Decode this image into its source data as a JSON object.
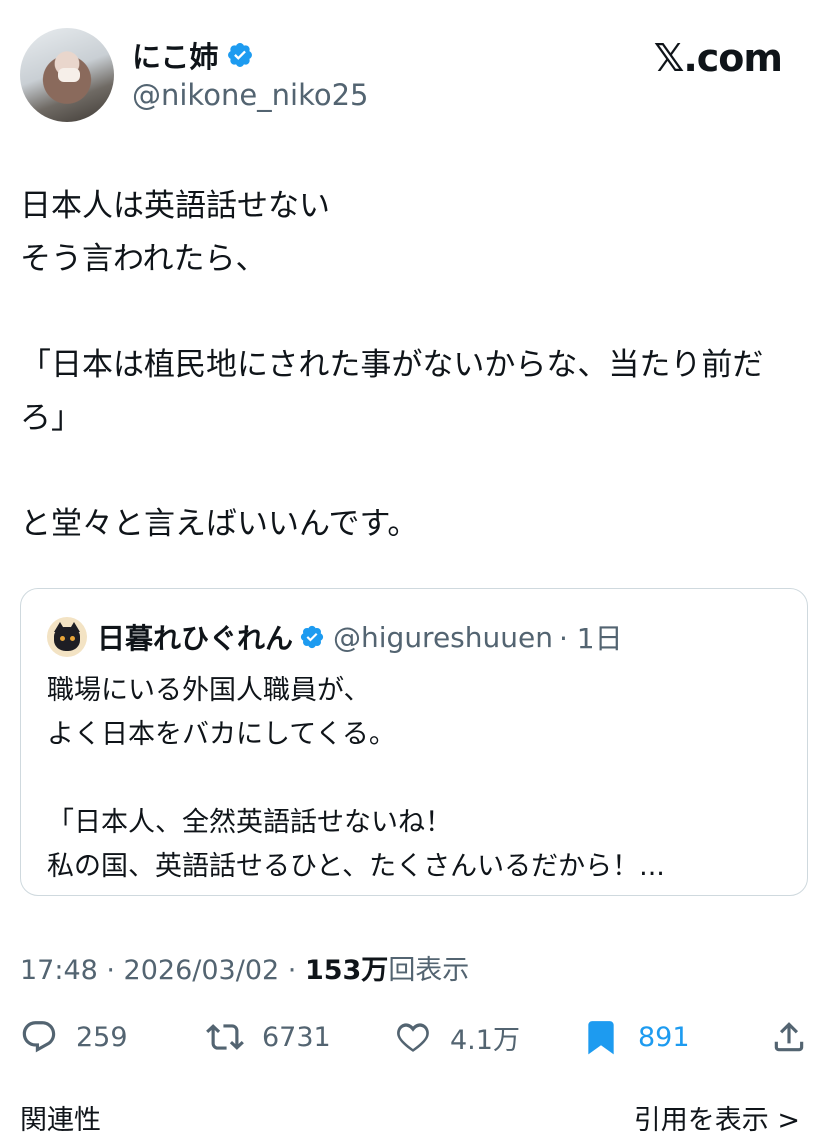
{
  "author": {
    "name": "にこ姉",
    "handle": "@nikone_niko25"
  },
  "brand": "𝕏.com",
  "tweet": {
    "text": "日本人は英語話せない\nそう言われたら、\n\n「日本は植民地にされた事がないからな、当たり前だろ」\n\nと堂々と言えばいいんです。"
  },
  "quoted": {
    "name": "日暮れひぐれん",
    "handle": "@higureshuuen",
    "time": "· 1日",
    "text": "職場にいる外国人職員が、\nよく日本をバカにしてくる。\n\n「日本人、全然英語話せないね！\n私の国、英語話せるひと、たくさんいるだから！..."
  },
  "meta": {
    "time": "17:48 · 2026/03/02 · ",
    "views_count": "153万",
    "views_label": "回表示"
  },
  "actions": {
    "reply_count": "259",
    "retweet_count": "6731",
    "like_count": "4.1万",
    "bookmark_count": "891"
  },
  "footer": {
    "left_label": "関連性",
    "right_label": "引用を表示 >"
  },
  "colors": {
    "accent": "#1d9bf0",
    "text": "#0f1419",
    "muted": "#536471",
    "border": "#cfd9de"
  }
}
